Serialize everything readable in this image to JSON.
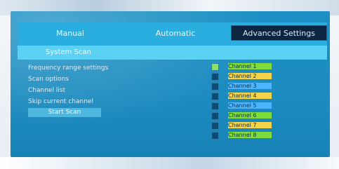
{
  "tabs": [
    {
      "label": "Manual"
    },
    {
      "label": "Automatic"
    },
    {
      "label": "Advanced Settings"
    }
  ],
  "subheader": {
    "title": "System Scan"
  },
  "left_rows": [
    {
      "label": "Frequency range settings"
    },
    {
      "label": "Scan options"
    },
    {
      "label": "Channel list"
    },
    {
      "label": "Skip current channel"
    }
  ],
  "hint_button": {
    "label": "Start Scan"
  },
  "right_list": [
    {
      "label": "Channel 1",
      "checked": true,
      "color": "#7fdc3a"
    },
    {
      "label": "Channel 2",
      "checked": false,
      "color": "#f2d34a"
    },
    {
      "label": "Channel 3",
      "checked": false,
      "color": "#4bb6ff"
    },
    {
      "label": "Channel 4",
      "checked": false,
      "color": "#f2d34a"
    },
    {
      "label": "Channel 5",
      "checked": false,
      "color": "#4bb6ff"
    },
    {
      "label": "Channel 6",
      "checked": false,
      "color": "#7fdc3a"
    },
    {
      "label": "Channel 7",
      "checked": false,
      "color": "#f2d34a"
    },
    {
      "label": "Channel 8",
      "checked": false,
      "color": "#7fdc3a"
    }
  ],
  "colors": {
    "screen_blue": "#1d8cc0",
    "tab_bar": "#2aaedf",
    "selected_tab": "#0c2540",
    "subheader": "#5bd2f3",
    "green": "#7fdc3a",
    "yellow": "#f2d34a",
    "light_blue": "#4bb6ff"
  }
}
